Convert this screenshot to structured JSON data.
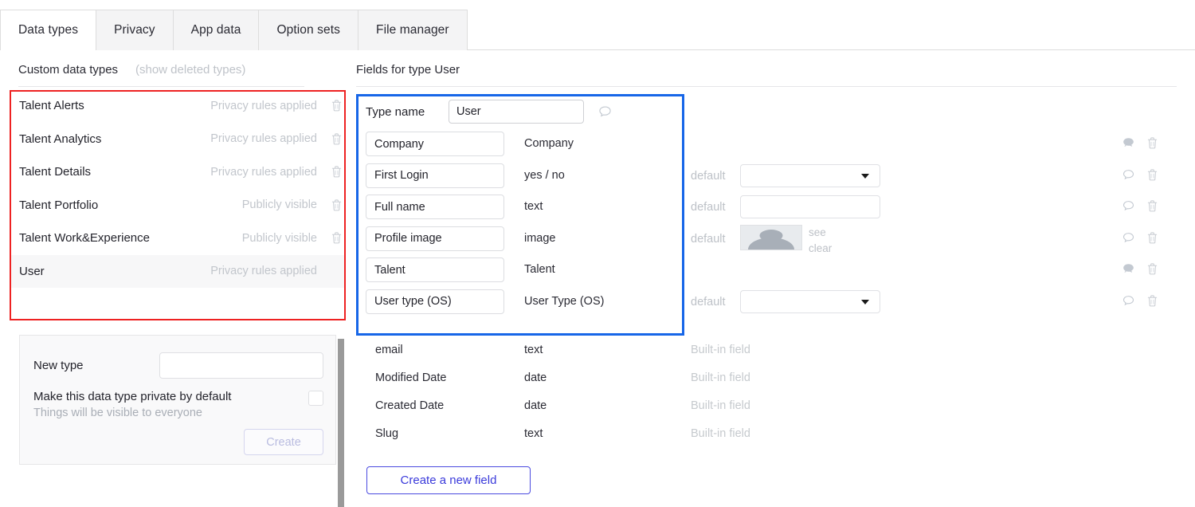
{
  "tabs": [
    {
      "label": "Data types",
      "active": true
    },
    {
      "label": "Privacy",
      "active": false
    },
    {
      "label": "App data",
      "active": false
    },
    {
      "label": "Option sets",
      "active": false
    },
    {
      "label": "File manager",
      "active": false
    }
  ],
  "left_panel": {
    "header": "Custom data types",
    "show_deleted_link": "(show deleted types)",
    "types": [
      {
        "name": "Talent Alerts",
        "privacy": "Privacy rules applied",
        "selected": false,
        "deletable": true
      },
      {
        "name": "Talent Analytics",
        "privacy": "Privacy rules applied",
        "selected": false,
        "deletable": true
      },
      {
        "name": "Talent Details",
        "privacy": "Privacy rules applied",
        "selected": false,
        "deletable": true
      },
      {
        "name": "Talent Portfolio",
        "privacy": "Publicly visible",
        "selected": false,
        "deletable": true
      },
      {
        "name": "Talent Work&Experience",
        "privacy": "Publicly visible",
        "selected": false,
        "deletable": true
      },
      {
        "name": "User",
        "privacy": "Privacy rules applied",
        "selected": true,
        "deletable": false
      }
    ],
    "new_type": {
      "label": "New type",
      "input_value": "",
      "input_placeholder": "",
      "private_title": "Make this data type private by default",
      "private_sub": "Things will be visible to everyone",
      "checkbox_checked": false,
      "create_label": "Create"
    }
  },
  "right_panel": {
    "header": "Fields for type User",
    "type_name_label": "Type name",
    "type_name_value": "User",
    "fields": [
      {
        "name": "Company",
        "type": "Company",
        "default_label": "",
        "control": "none",
        "bubble": "filled"
      },
      {
        "name": "First Login",
        "type": "yes / no",
        "default_label": "default",
        "control": "select",
        "bubble": "outline"
      },
      {
        "name": "Full name",
        "type": "text",
        "default_label": "default",
        "control": "text",
        "bubble": "outline"
      },
      {
        "name": "Profile image",
        "type": "image",
        "default_label": "default",
        "control": "image",
        "bubble": "outline",
        "image_links": [
          "see",
          "clear"
        ]
      },
      {
        "name": "Talent",
        "type": "Talent",
        "default_label": "",
        "control": "none",
        "bubble": "filled"
      },
      {
        "name": "User type (OS)",
        "type": "User Type (OS)",
        "default_label": "default",
        "control": "select",
        "bubble": "outline"
      }
    ],
    "builtin_fields": [
      {
        "name": "email",
        "type": "text",
        "tag": "Built-in field"
      },
      {
        "name": "Modified Date",
        "type": "date",
        "tag": "Built-in field"
      },
      {
        "name": "Created Date",
        "type": "date",
        "tag": "Built-in field"
      },
      {
        "name": "Slug",
        "type": "text",
        "tag": "Built-in field"
      }
    ],
    "create_field_label": "Create a new field"
  },
  "annotations": {
    "red_highlight_color": "#ee2222",
    "blue_highlight_color": "#1766e8"
  }
}
